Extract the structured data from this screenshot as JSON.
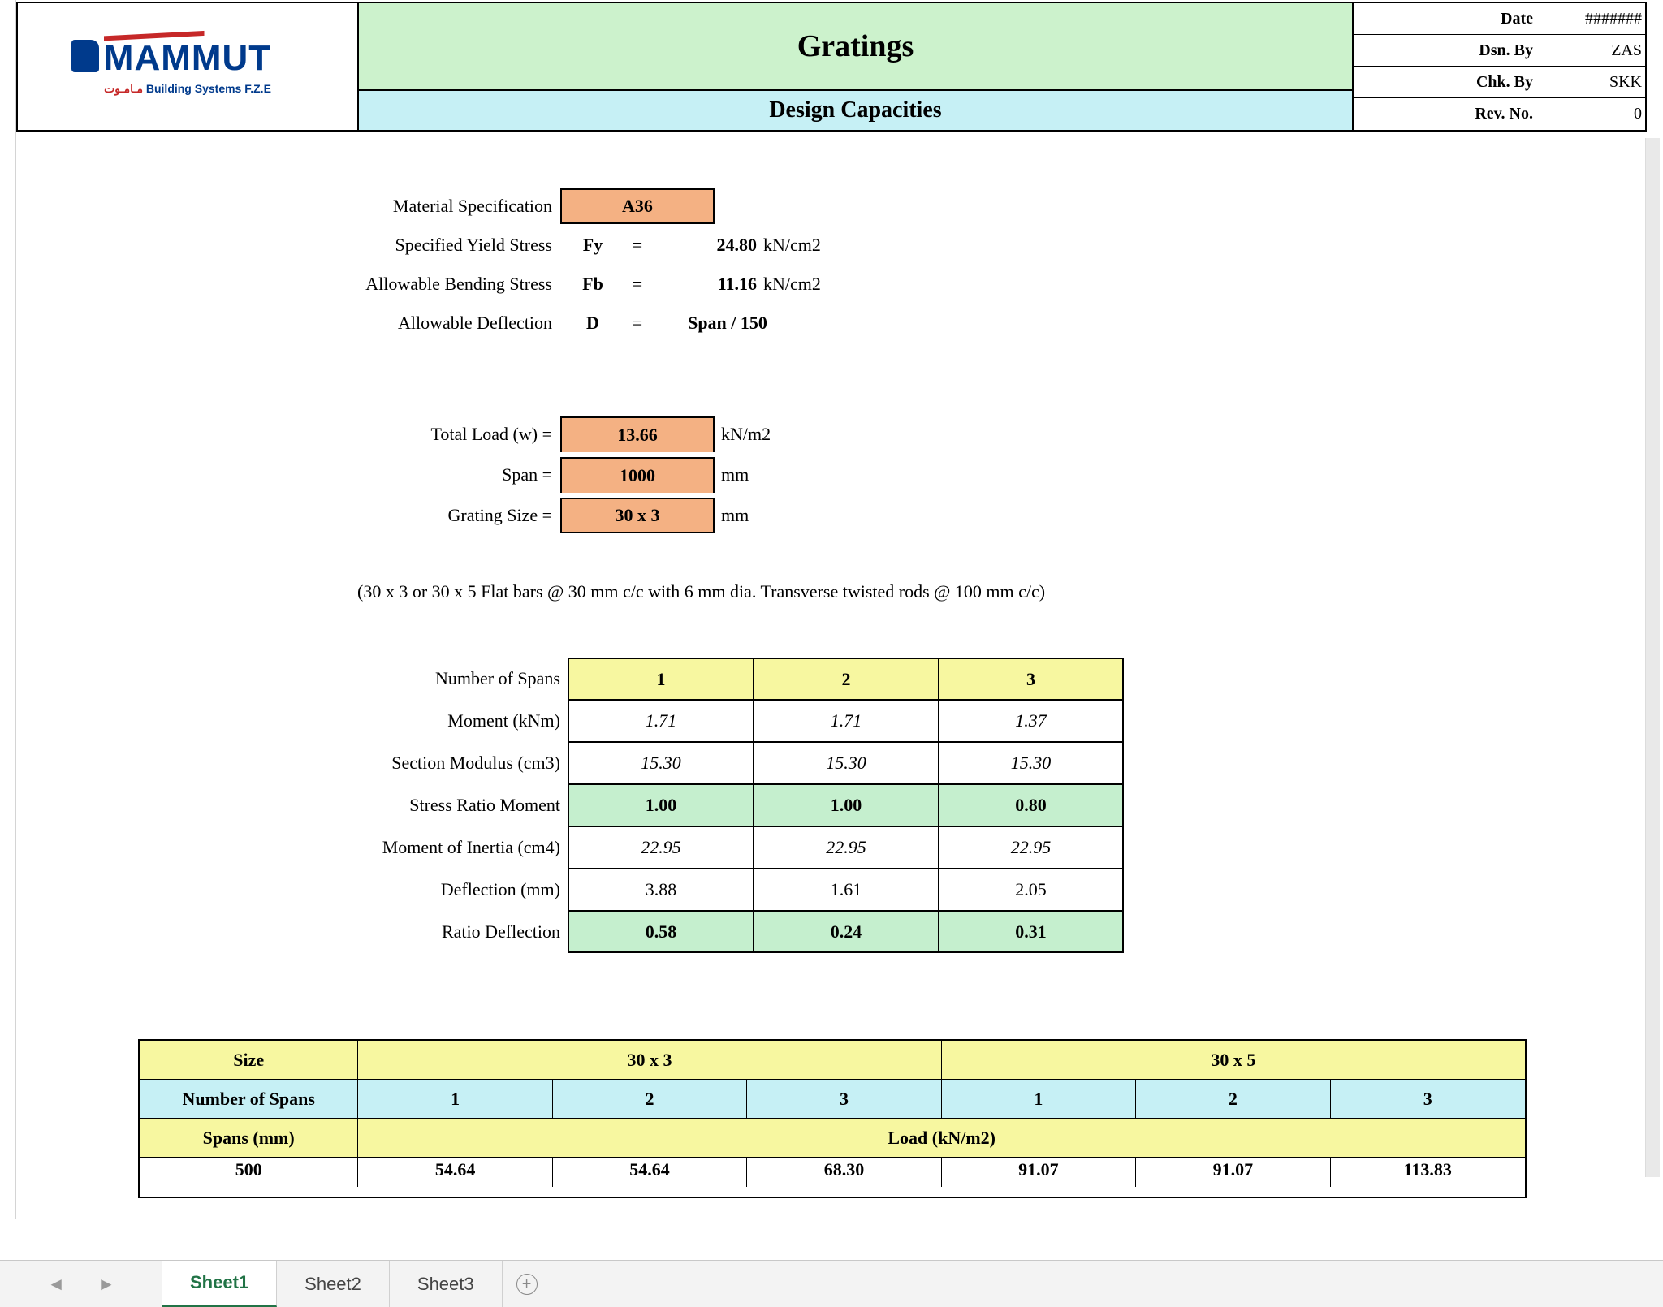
{
  "header": {
    "logo_main": "MAMMUT",
    "logo_sub_ar": "مـامـوت",
    "logo_sub_en": "Building Systems F.Z.E",
    "title": "Gratings",
    "subtitle": "Design Capacities",
    "meta": [
      {
        "k": "Date",
        "v": "#######"
      },
      {
        "k": "Dsn. By",
        "v": "ZAS"
      },
      {
        "k": "Chk. By",
        "v": "SKK"
      },
      {
        "k": "Rev. No.",
        "v": "0"
      }
    ]
  },
  "spec": {
    "material_label": "Material Specification",
    "material_value": "A36",
    "rows": [
      {
        "label": "Specified Yield Stress",
        "sym": "Fy",
        "val": "24.80",
        "unit": "kN/cm2"
      },
      {
        "label": "Allowable Bending Stress",
        "sym": "Fb",
        "val": "11.16",
        "unit": "kN/cm2"
      },
      {
        "label": "Allowable Deflection",
        "sym": "D",
        "val": "Span / 150",
        "unit": ""
      }
    ]
  },
  "inputs": {
    "rows": [
      {
        "label": "Total Load  (w) =",
        "val": "13.66",
        "unit": "kN/m2"
      },
      {
        "label": "Span =",
        "val": "1000",
        "unit": "mm"
      },
      {
        "label": "Grating Size =",
        "val": "30 x 3",
        "unit": "mm"
      }
    ],
    "note": "(30 x 3 or 30 x 5 Flat bars @ 30 mm c/c with 6 mm dia. Transverse twisted rods @ 100 mm c/c)"
  },
  "spans_table": {
    "row_labels": [
      "Number of Spans",
      "Moment (kNm)",
      "Section Modulus (cm3)",
      "Stress Ratio Moment",
      "Moment of Inertia (cm4)",
      "Deflection (mm)",
      "Ratio Deflection"
    ],
    "cols": [
      "1",
      "2",
      "3"
    ],
    "rows": [
      {
        "style": "hd",
        "cells": [
          "1",
          "2",
          "3"
        ]
      },
      {
        "style": "it",
        "cells": [
          "1.71",
          "1.71",
          "1.37"
        ]
      },
      {
        "style": "it",
        "cells": [
          "15.30",
          "15.30",
          "15.30"
        ]
      },
      {
        "style": "grn",
        "cells": [
          "1.00",
          "1.00",
          "0.80"
        ]
      },
      {
        "style": "it",
        "cells": [
          "22.95",
          "22.95",
          "22.95"
        ]
      },
      {
        "style": "",
        "cells": [
          "3.88",
          "1.61",
          "2.05"
        ]
      },
      {
        "style": "grn",
        "cells": [
          "0.58",
          "0.24",
          "0.31"
        ]
      }
    ]
  },
  "load_table": {
    "size_hdr": "Size",
    "sizes": [
      "30 x 3",
      "30 x 5"
    ],
    "nspans_hdr": "Number of Spans",
    "nspans": [
      "1",
      "2",
      "3",
      "1",
      "2",
      "3"
    ],
    "spansmm_hdr": "Spans (mm)",
    "load_hdr": "Load (kN/m2)",
    "partial_row": {
      "span": "500",
      "vals": [
        "54.64",
        "54.64",
        "68.30",
        "91.07",
        "91.07",
        "113.83"
      ]
    }
  },
  "tabs": {
    "items": [
      "Sheet1",
      "Sheet2",
      "Sheet3"
    ],
    "active": 0,
    "nav_left": "◄",
    "nav_right": "►",
    "add": "+"
  }
}
